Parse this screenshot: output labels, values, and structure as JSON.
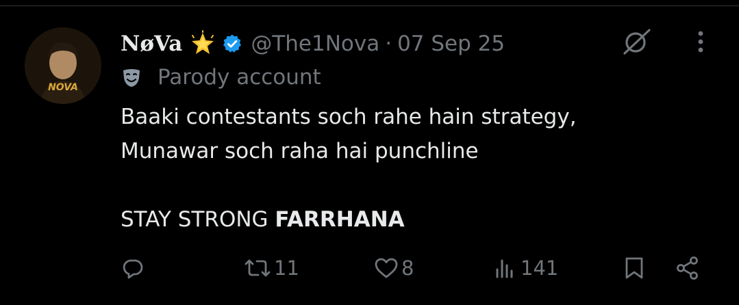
{
  "tweet": {
    "author": {
      "display_name": "NøVa",
      "handle": "@The1Nova",
      "separator": "·",
      "date": "07 Sep 25",
      "badge_icon": "glowing-star-icon",
      "verified_icon": "verified-badge-icon",
      "label_icon": "theater-mask-icon",
      "label_text": "Parody account",
      "avatar_text": "NOVA"
    },
    "text_lines": [
      "Baaki contestants soch rahe hain strategy,",
      "Munawar soch raha hai punchline"
    ],
    "text_emphasis_prefix": "STAY STRONG ",
    "text_emphasis_bold": "FARRHANA",
    "actions": {
      "reply": {
        "icon": "reply-icon",
        "count": ""
      },
      "repost": {
        "icon": "repost-icon",
        "count": "11"
      },
      "like": {
        "icon": "heart-icon",
        "count": "8"
      },
      "views": {
        "icon": "views-icon",
        "count": "141"
      },
      "bookmark": {
        "icon": "bookmark-icon"
      },
      "share": {
        "icon": "share-icon"
      }
    },
    "header_icons": {
      "grok": "grok-icon",
      "more": "more-options-icon"
    }
  },
  "colors": {
    "background": "#000000",
    "primary_text": "#e7e9ea",
    "secondary_text": "#71767b",
    "verified_blue": "#1d9bf0",
    "divider": "#2f3336"
  }
}
